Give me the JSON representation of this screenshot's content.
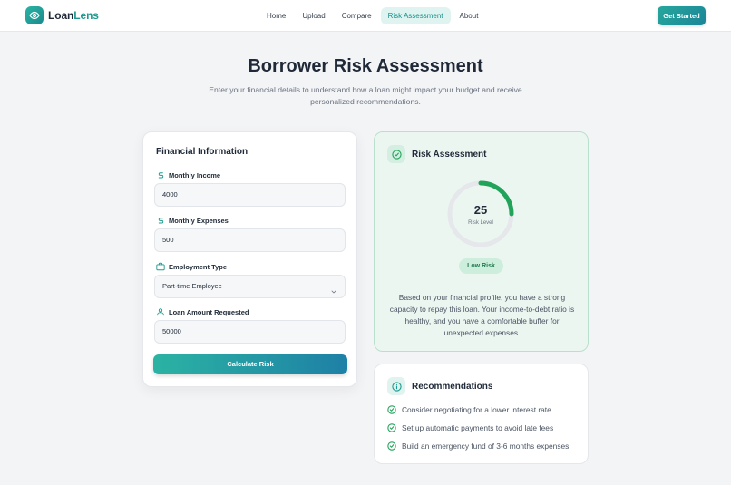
{
  "app": {
    "brand_part1": "Loan",
    "brand_part2": "Lens",
    "logo_icon": "eye-icon",
    "accent": "#1d9a8f"
  },
  "nav": {
    "items": [
      {
        "label": "Home"
      },
      {
        "label": "Upload"
      },
      {
        "label": "Compare"
      },
      {
        "label": "Risk Assessment",
        "active": true
      },
      {
        "label": "About"
      }
    ],
    "cta_label": "Get Started"
  },
  "page": {
    "title": "Borrower Risk Assessment",
    "subtitle": "Enter your financial details to understand how a loan might impact your budget and receive personalized recommendations."
  },
  "form": {
    "title": "Financial Information",
    "fields": {
      "income": {
        "label": "Monthly Income",
        "value": "4000",
        "icon": "dollar-icon"
      },
      "expenses": {
        "label": "Monthly Expenses",
        "value": "500",
        "icon": "dollar-icon"
      },
      "employment": {
        "label": "Employment Type",
        "value": "Part-time Employee",
        "icon": "briefcase-icon"
      },
      "loan": {
        "label": "Loan Amount Requested",
        "value": "50000",
        "icon": "user-icon"
      }
    },
    "submit_label": "Calculate Risk"
  },
  "risk": {
    "title": "Risk Assessment",
    "score": "25",
    "score_fraction": 0.25,
    "score_caption": "Risk Level",
    "level": "Low Risk",
    "description": "Based on your financial profile, you have a strong capacity to repay this loan. Your income-to-debt ratio is healthy, and you have a comfortable buffer for unexpected expenses.",
    "colors": {
      "good": "#22a35a",
      "track": "#e5e7eb"
    }
  },
  "recommendations": {
    "title": "Recommendations",
    "items": [
      "Consider negotiating for a lower interest rate",
      "Set up automatic payments to avoid late fees",
      "Build an emergency fund of 3-6 months expenses"
    ]
  }
}
